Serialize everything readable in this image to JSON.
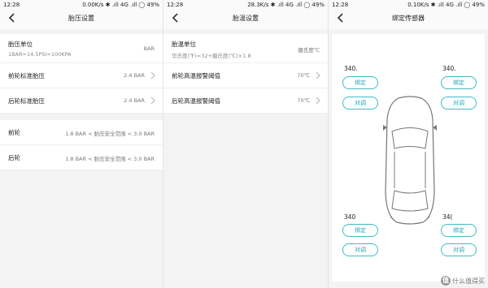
{
  "screen1": {
    "status": {
      "time": "12:28",
      "right": "0.00K/s ✱ .ıll 4G .ıll ◯ 49%"
    },
    "title": "胎压设置",
    "rows": [
      {
        "label": "胎压单位",
        "sub": "1BAR=14.5PSI=100KPA",
        "value": "BAR"
      },
      {
        "label": "前轮标准胎压",
        "value": "2.4 BAR"
      },
      {
        "label": "后轮标准胎压",
        "value": "2.4 BAR"
      },
      {
        "label": "前轮",
        "value": "1.8 BAR < 胎压安全范围 < 3.0 BAR"
      },
      {
        "label": "后轮",
        "value": "1.8 BAR < 胎压安全范围 < 3.0 BAR"
      }
    ]
  },
  "screen2": {
    "status": {
      "time": "12:28",
      "right": "28.3K/s ✱ .ıll 4G .ıll ◯ 49%"
    },
    "title": "胎温设置",
    "rows": [
      {
        "label": "胎温单位",
        "sub": "华氏度(℉)=32+摄氏度(℃)×1.8",
        "value": "摄氏度℃"
      },
      {
        "label": "前轮高温报警阈值",
        "value": "70℃"
      },
      {
        "label": "后轮高温报警阈值",
        "value": "70℃"
      }
    ]
  },
  "screen3": {
    "status": {
      "time": "12:28",
      "right": "0.10K/s ✱ .ıll 4G .ıll ◯ 49%"
    },
    "title": "绑定传感器",
    "sensors": [
      {
        "num": "340.",
        "bind": "绑定",
        "pair": "对调"
      },
      {
        "num": "340.",
        "bind": "绑定",
        "pair": "对调"
      },
      {
        "num": "340",
        "bind": "绑定",
        "pair": "对调"
      },
      {
        "num": "34(",
        "bind": "绑定",
        "pair": "对调"
      }
    ]
  },
  "watermark": {
    "logo": "值",
    "text": "什么值得买"
  },
  "colors": {
    "accent": "#3dbcc4",
    "background": "#f3f3f3"
  }
}
